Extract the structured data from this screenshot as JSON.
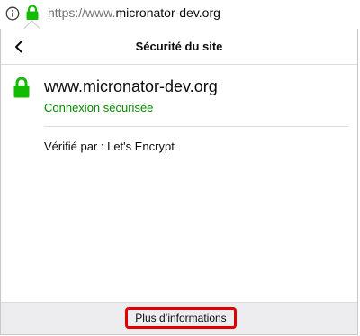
{
  "urlbar": {
    "url_scheme": "https://www.",
    "url_host": "micronator-dev.org",
    "info_icon": "info-icon",
    "lock_icon": "lock-icon",
    "lock_color": "#12bc00"
  },
  "panel": {
    "title": "Sécurité du site",
    "back_icon": "chevron-left-icon",
    "site": {
      "host": "www.micronator-dev.org",
      "status": "Connexion sécurisée",
      "status_color": "#058b00",
      "verified_by": "Vérifié par : Let's Encrypt"
    },
    "footer": {
      "more_info_label": "Plus d’informations",
      "highlight_color": "#e10000"
    }
  }
}
